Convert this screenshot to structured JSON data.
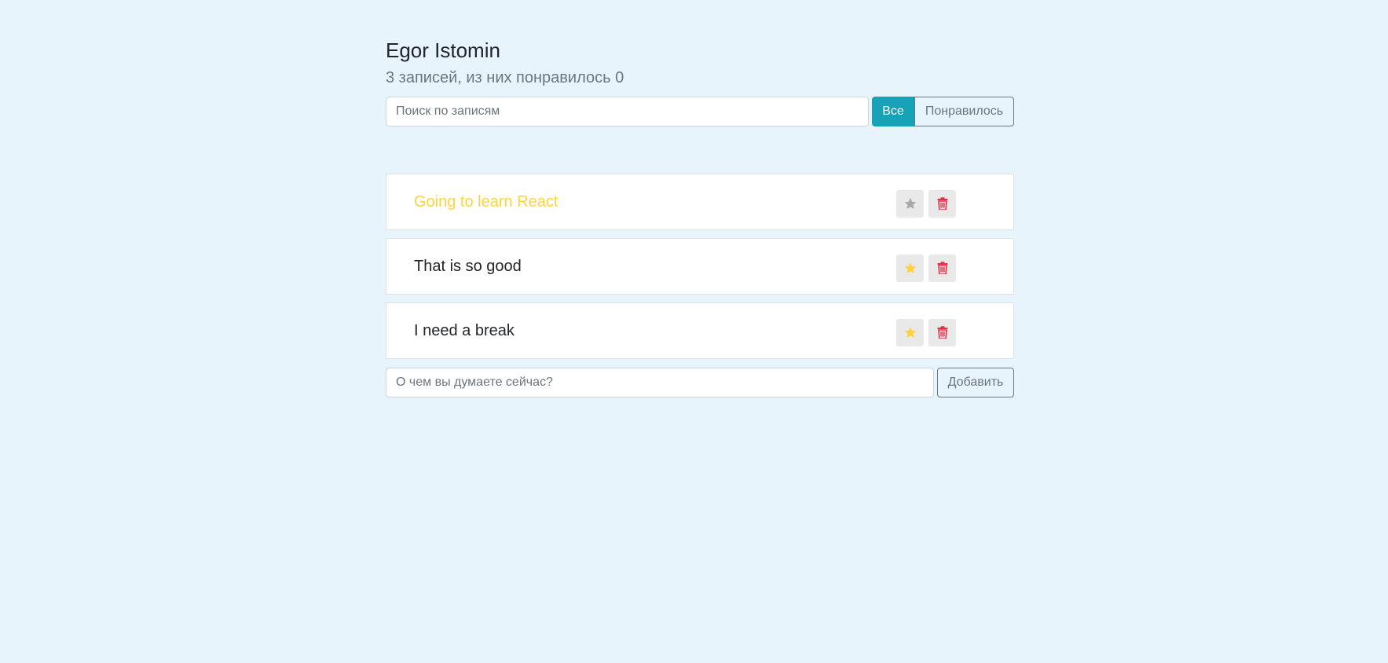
{
  "header": {
    "title": "Egor Istomin",
    "subtitle": "3 записей, из них понравилось 0"
  },
  "search": {
    "placeholder": "Поиск по записям",
    "value": ""
  },
  "filters": {
    "all_label": "Все",
    "liked_label": "Понравилось",
    "active": "all"
  },
  "posts": [
    {
      "label": "Going to learn React",
      "important": true,
      "star_color": "#a8a8a8",
      "star_icon": "star-icon",
      "delete_icon": "trash-icon"
    },
    {
      "label": "That is so good",
      "important": false,
      "star_color": "#ffd43b",
      "star_icon": "star-icon",
      "delete_icon": "trash-icon"
    },
    {
      "label": "I need a break",
      "important": false,
      "star_color": "#ffd43b",
      "star_icon": "star-icon",
      "delete_icon": "trash-icon"
    }
  ],
  "add_form": {
    "placeholder": "О чем вы думаете сейчас?",
    "value": "",
    "button_label": "Добавить"
  },
  "colors": {
    "background": "#e8f4fb",
    "accent": "#17a2b8",
    "important_text": "#ffd43b",
    "delete": "#dc3545"
  }
}
